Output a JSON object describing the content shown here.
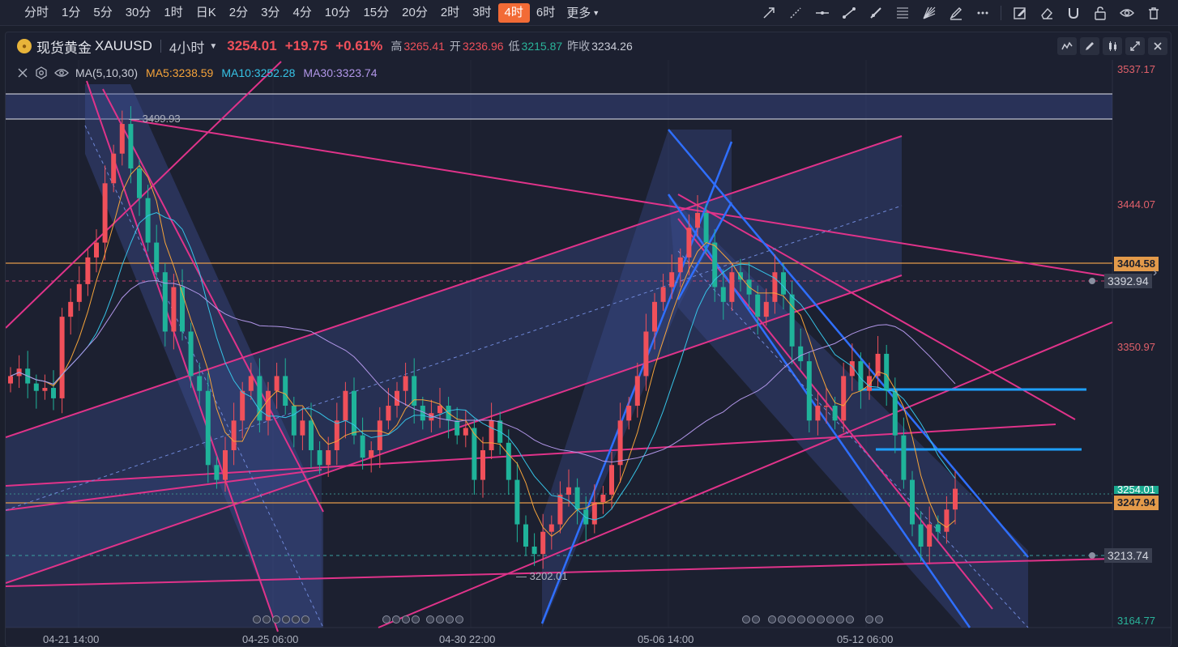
{
  "toolbar": {
    "intervals": [
      "分时",
      "1分",
      "5分",
      "30分",
      "1时",
      "日K",
      "2分",
      "3分",
      "4分",
      "10分",
      "15分",
      "20分",
      "2时",
      "3时",
      "4时",
      "6时"
    ],
    "active_interval": "4时",
    "more_label": "更多",
    "draw_tools": [
      "arrow-icon",
      "dashed-ray-icon",
      "horizontal-line-icon",
      "trend-line-icon",
      "segment-icon",
      "fibonacci-icon",
      "gann-fan-icon",
      "brush-icon",
      "more-dots-icon",
      "edit-icon",
      "eraser-icon",
      "magnet-icon",
      "lock-icon",
      "eye-icon",
      "trash-icon"
    ]
  },
  "symbol": {
    "name": "现货黄金",
    "code": "XAUUSD",
    "period": "4小时",
    "price": "3254.01",
    "change": "+19.75",
    "change_pct": "+0.61%",
    "high_label": "高",
    "high": "3265.41",
    "open_label": "开",
    "open": "3236.96",
    "low_label": "低",
    "low": "3215.87",
    "prev_close_label": "昨收",
    "prev_close": "3234.26"
  },
  "indicator": {
    "title": "MA(5,10,30)",
    "ma5": "MA5:3238.59",
    "ma10": "MA10:3252.28",
    "ma30": "MA30:3323.74"
  },
  "colors": {
    "up": "#f0505a",
    "down": "#1fb39a",
    "ma5": "#f5a33a",
    "ma10": "#36c3e6",
    "ma30": "#b196e8",
    "pink_line": "#e0338a",
    "blue_line": "#2f6fff",
    "highlight_blue": "#1ea0ff",
    "orange_line": "#e39a4a",
    "accent": "#f26b36"
  },
  "price_axis": {
    "labels": [
      "3537.17",
      "3444.07",
      "3350.97",
      "3164.77"
    ],
    "tags": {
      "orange_top": "3404.58",
      "gray_top": "3392.94",
      "current": "3254.01",
      "orange_bottom": "3247.94",
      "gray_bottom": "3213.74"
    }
  },
  "annotations": {
    "peak": "3499.93",
    "trough": "3202.01"
  },
  "time_axis": [
    "04-21 14:00",
    "04-25 06:00",
    "04-30 22:00",
    "05-06 14:00",
    "05-12 06:00"
  ],
  "chart_data": {
    "type": "candlestick",
    "symbol": "XAUUSD",
    "interval": "4小时",
    "ylim": [
      3164.77,
      3537.17
    ],
    "x_ticks": [
      "04-21 14:00",
      "04-25 06:00",
      "04-30 22:00",
      "05-06 14:00",
      "05-12 06:00"
    ],
    "candles_close": [
      3330,
      3335,
      3325,
      3320,
      3322,
      3315,
      3370,
      3380,
      3392,
      3410,
      3420,
      3460,
      3480,
      3500,
      3470,
      3450,
      3420,
      3400,
      3360,
      3390,
      3360,
      3330,
      3320,
      3270,
      3260,
      3280,
      3300,
      3320,
      3330,
      3300,
      3320,
      3330,
      3310,
      3290,
      3300,
      3280,
      3270,
      3280,
      3300,
      3320,
      3290,
      3275,
      3280,
      3300,
      3310,
      3320,
      3330,
      3310,
      3300,
      3305,
      3310,
      3300,
      3290,
      3295,
      3260,
      3280,
      3300,
      3285,
      3260,
      3230,
      3215,
      3210,
      3225,
      3230,
      3250,
      3255,
      3240,
      3230,
      3245,
      3250,
      3270,
      3300,
      3310,
      3330,
      3360,
      3380,
      3390,
      3400,
      3410,
      3430,
      3440,
      3420,
      3390,
      3380,
      3400,
      3395,
      3385,
      3370,
      3380,
      3400,
      3385,
      3350,
      3340,
      3300,
      3310,
      3310,
      3300,
      3330,
      3340,
      3320,
      3330,
      3345,
      3320,
      3290,
      3260,
      3230,
      3215,
      3230,
      3225,
      3240,
      3254
    ]
  }
}
